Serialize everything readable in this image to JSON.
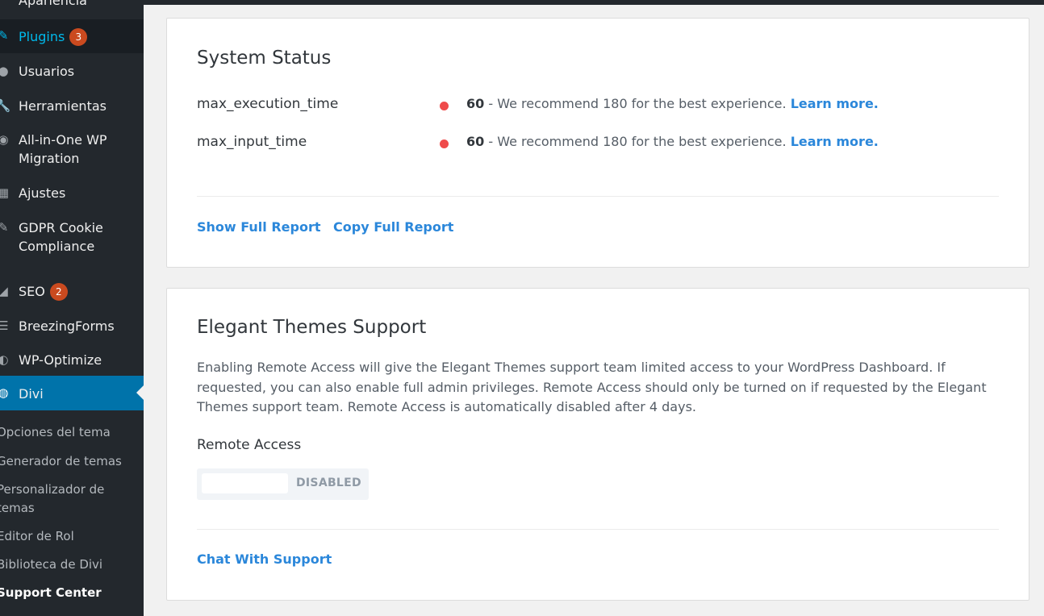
{
  "sidebar": {
    "partial_top_item": "Apariencia",
    "items": [
      {
        "label": "Plugins",
        "badge": "3"
      },
      {
        "label": "Usuarios"
      },
      {
        "label": "Herramientas"
      },
      {
        "label": "All-in-One WP Migration"
      },
      {
        "label": "Ajustes"
      },
      {
        "label": "GDPR Cookie Compliance"
      },
      {
        "label": "SEO",
        "badge": "2"
      },
      {
        "label": "BreezingForms"
      },
      {
        "label": "WP-Optimize"
      },
      {
        "label": "Divi"
      }
    ],
    "submenu": [
      "Opciones del tema",
      "Generador de temas",
      "Personalizador de temas",
      "Editor de Rol",
      "Biblioteca de Divi",
      "Support Center"
    ]
  },
  "system_status": {
    "title": "System Status",
    "rows": [
      {
        "name": "max_execution_time",
        "value": "60",
        "message": " - We recommend 180 for the best experience. ",
        "link": "Learn more."
      },
      {
        "name": "max_input_time",
        "value": "60",
        "message": " - We recommend 180 for the best experience. ",
        "link": "Learn more."
      }
    ],
    "show_full_report": "Show Full Report",
    "copy_full_report": "Copy Full Report"
  },
  "support": {
    "title": "Elegant Themes Support",
    "description": "Enabling Remote Access will give the Elegant Themes support team limited access to your WordPress Dashboard. If requested, you can also enable full admin privileges. Remote Access should only be turned on if requested by the Elegant Themes support team. Remote Access is automatically disabled after 4 days.",
    "remote_access_label": "Remote Access",
    "toggle_state": "DISABLED",
    "chat_link": "Chat With Support"
  },
  "colors": {
    "sidebar_bg": "#23282d",
    "accent": "#0073aa",
    "link": "#2b87da",
    "status_error": "#ef4b4b",
    "badge": "#ca4a1f"
  }
}
